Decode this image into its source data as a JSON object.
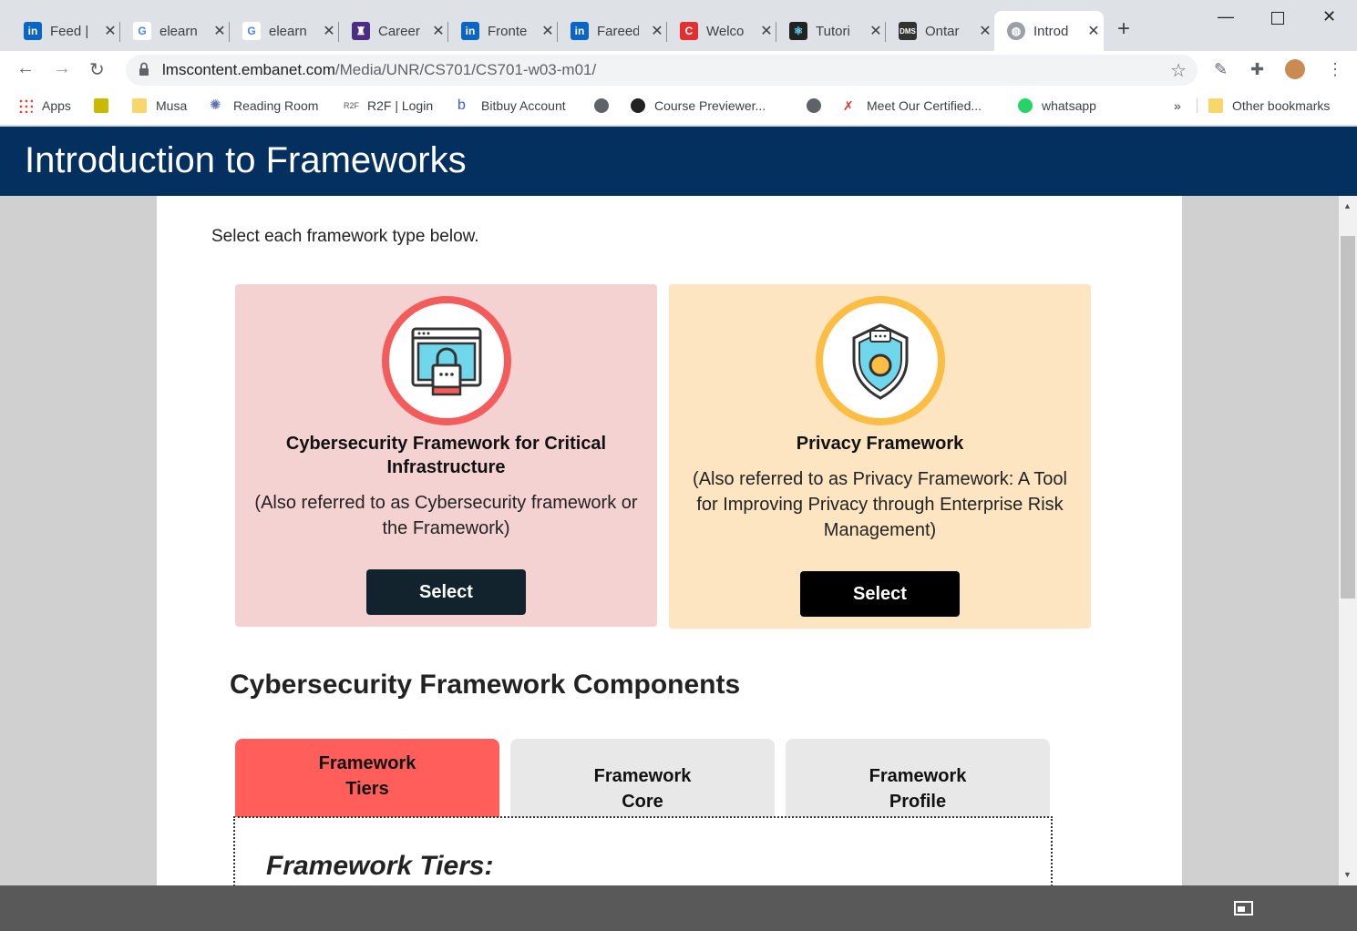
{
  "browser": {
    "tabs": [
      {
        "title": "Feed |",
        "icon": "linkedin-icon"
      },
      {
        "title": "elearn",
        "icon": "google-icon"
      },
      {
        "title": "elearn",
        "icon": "google-icon"
      },
      {
        "title": "Career",
        "icon": "university-crest-icon"
      },
      {
        "title": "Fronte",
        "icon": "linkedin-icon"
      },
      {
        "title": "Fareed",
        "icon": "linkedin-icon"
      },
      {
        "title": "Welco",
        "icon": "red-c-icon"
      },
      {
        "title": "Tutori",
        "icon": "react-icon"
      },
      {
        "title": "Ontar",
        "icon": "dms-icon"
      },
      {
        "title": "Introd",
        "icon": "globe-icon",
        "active": true
      }
    ],
    "url_host": "lmscontent.embanet.com",
    "url_path": "/Media/UNR/CS701/CS701-w03-m01/",
    "bookmarks": [
      {
        "label": "Apps",
        "icon": "apps-grid-icon"
      },
      {
        "label": "",
        "icon": "cartoon-icon"
      },
      {
        "label": "Musa",
        "icon": "folder-icon"
      },
      {
        "label": "Reading Room",
        "icon": "sparkle-icon"
      },
      {
        "label": "R2F | Login",
        "icon": "r2f-icon"
      },
      {
        "label": "Bitbuy Account",
        "icon": "bitbuy-icon"
      },
      {
        "label": "",
        "icon": "globe-icon"
      },
      {
        "label": "Course Previewer...",
        "icon": "heart-shield-icon"
      },
      {
        "label": "",
        "icon": "globe-icon"
      },
      {
        "label": "Meet Our Certified...",
        "icon": "x-logo-icon"
      },
      {
        "label": "whatsapp",
        "icon": "whatsapp-icon"
      }
    ],
    "overflow_label": "»",
    "other_bookmarks": "Other bookmarks"
  },
  "page": {
    "title": "Introduction to Frameworks",
    "instruction": "Select each framework type below.",
    "cards": [
      {
        "heading": "Cybersecurity Framework for Critical Infrastructure",
        "description": "(Also referred to as Cybersecurity framework or the Framework)",
        "button": "Select",
        "icon": "browser-lock-icon",
        "color": "#f5d2d2",
        "ring_color": "#f45b5b"
      },
      {
        "heading": "Privacy Framework",
        "description": "(Also referred to as Privacy Framework: A Tool for Improving Privacy through Enterprise Risk Management)",
        "button": "Select",
        "icon": "shield-icon",
        "color": "#fde5c1",
        "ring_color": "#fbbd43"
      }
    ],
    "components_title": "Cybersecurity Framework Components",
    "component_tabs": [
      {
        "label": "Framework Tiers",
        "active": true
      },
      {
        "label": "Framework Core",
        "active": false
      },
      {
        "label": "Framework Profile",
        "active": false
      }
    ],
    "panel_heading": "Framework Tiers:"
  },
  "colors": {
    "banner": "#03305f",
    "active_tab": "#ff5e5b",
    "inactive_tab": "#e8e8e8"
  }
}
